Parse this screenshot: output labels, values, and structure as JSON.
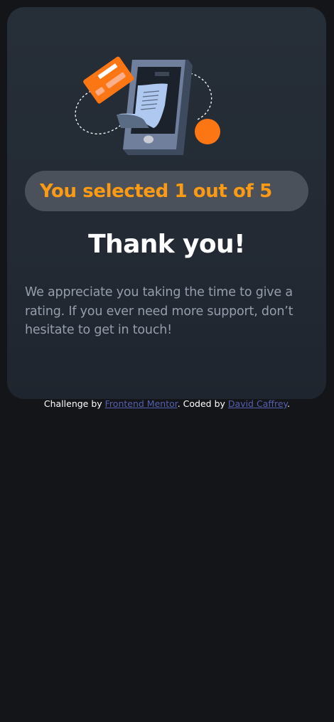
{
  "card": {
    "selection_text": "You selected 1 out of 5",
    "title": "Thank you!",
    "message": "We appreciate you taking the time to give a rating. If you ever need more support, don’t hesitate to get in touch!"
  },
  "illustration": {
    "icon": "payment-phone-illustration"
  },
  "attribution": {
    "prefix": "Challenge by ",
    "link1": "Frontend Mentor",
    "middle": ". Coded by ",
    "link2": "David Caffrey",
    "suffix": "."
  },
  "colors": {
    "background": "#131518",
    "card": "#262e38",
    "accent": "#fc9b13",
    "pill": "#4b515a",
    "muted_text": "#959eac",
    "link": "#5560b0"
  }
}
